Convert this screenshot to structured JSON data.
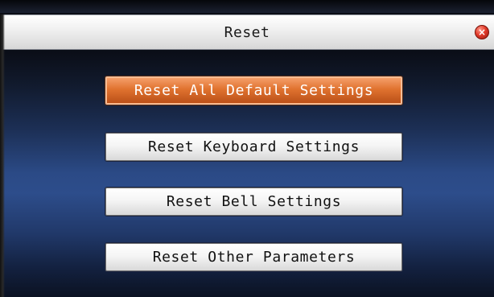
{
  "window": {
    "title": "Reset",
    "close_icon": "close-icon",
    "close_color": "#e23b2b"
  },
  "menu": {
    "items": [
      {
        "label": "Reset All Default Settings",
        "selected": true
      },
      {
        "label": "Reset Keyboard Settings",
        "selected": false
      },
      {
        "label": "Reset Bell Settings",
        "selected": false
      },
      {
        "label": "Reset Other Parameters",
        "selected": false
      }
    ],
    "selected_color": "#e0722f"
  }
}
